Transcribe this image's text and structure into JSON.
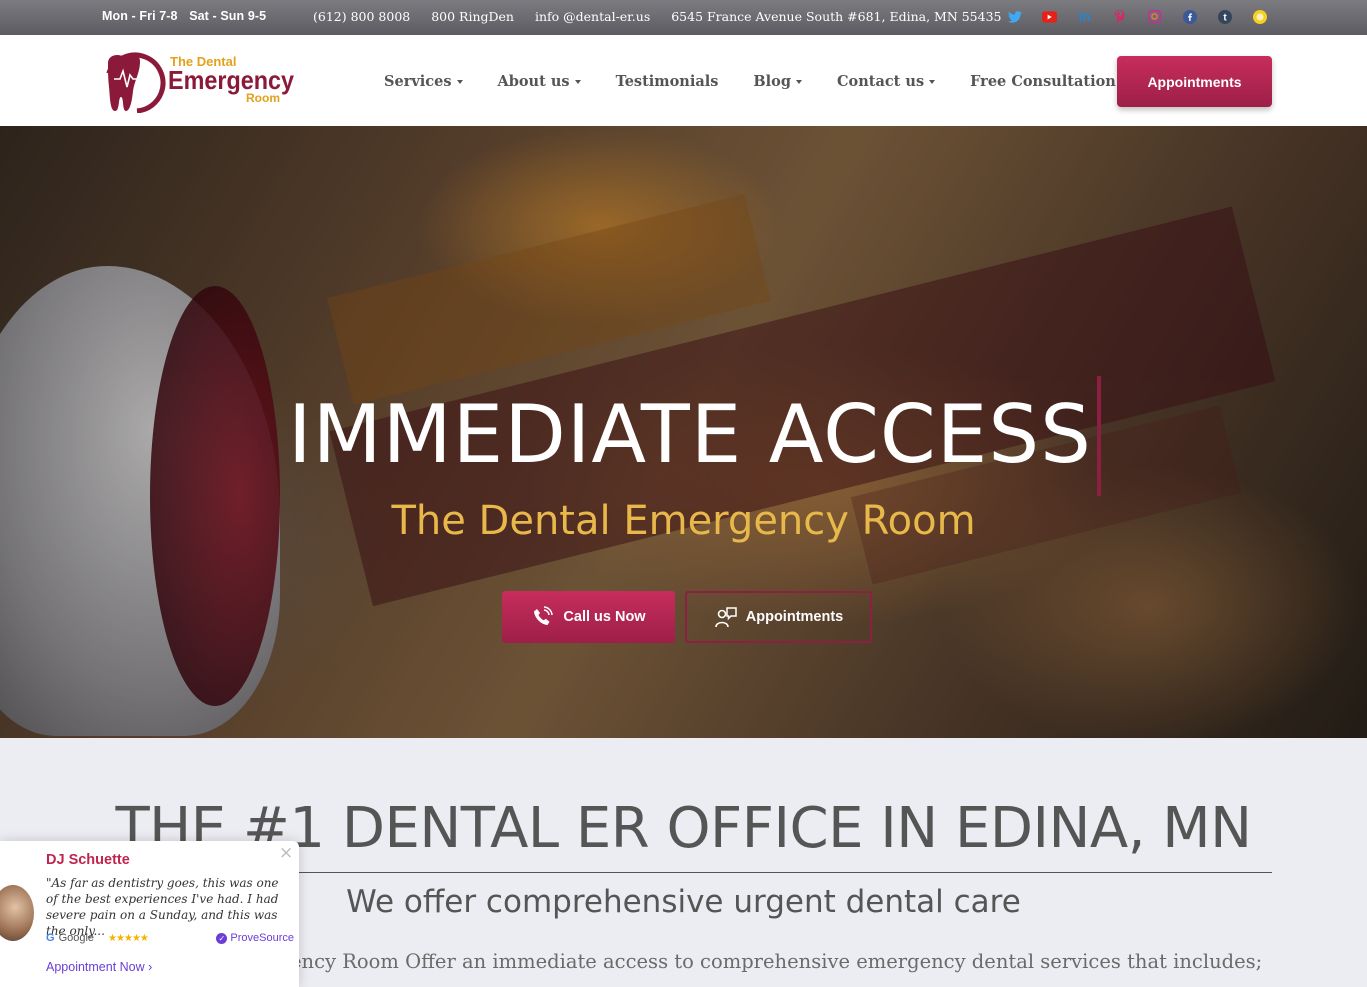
{
  "topbar": {
    "hours_weekday": "Mon - Fri 7-8",
    "hours_weekend": "Sat - Sun 9-5",
    "phone": "(612) 800 8008",
    "phone_alt": "800 RingDen",
    "email": "info @dental-er.us",
    "address": "6545 France Avenue South #681, Edina, MN 55435",
    "social": [
      {
        "name": "twitter-icon",
        "color": "#3fa9f5"
      },
      {
        "name": "youtube-icon",
        "color": "#e62117"
      },
      {
        "name": "linkedin-icon",
        "color": "#1e88d6"
      },
      {
        "name": "pinterest-icon",
        "color": "#e0245e"
      },
      {
        "name": "instagram-icon",
        "color": "#d6249f"
      },
      {
        "name": "facebook-icon",
        "color": "#3b5998"
      },
      {
        "name": "tumblr-icon",
        "color": "#35465c"
      },
      {
        "name": "yelp-icon",
        "color": "#f5d020"
      }
    ]
  },
  "nav": {
    "logo": {
      "line1": "The Dental",
      "line2": "Emergency",
      "line3": "Room"
    },
    "items": [
      {
        "label": "Services",
        "dropdown": true
      },
      {
        "label": "About us",
        "dropdown": true
      },
      {
        "label": "Testimonials",
        "dropdown": false
      },
      {
        "label": "Blog",
        "dropdown": true
      },
      {
        "label": "Contact us",
        "dropdown": true
      },
      {
        "label": "Free Consultation",
        "dropdown": false
      }
    ],
    "appointments_label": "Appointments"
  },
  "hero": {
    "title": "IMMEDIATE ACCESS",
    "subtitle": "The Dental Emergency Room",
    "call_label": "Call us Now",
    "appointments_label": "Appointments"
  },
  "section": {
    "title": "THE #1 DENTAL ER OFFICE IN EDINA, MN",
    "subtitle": "We offer comprehensive urgent dental care",
    "body": "ency Room Offer an immediate access to comprehensive emergency dental services that includes;"
  },
  "review": {
    "name": "DJ Schuette",
    "quote": "\"As far as dentistry goes, this was one of the best experiences I've had. I had severe pain on a Sunday, and this was the only...",
    "source": "Google",
    "verified_by": "ProveSource",
    "cta": "Appointment Now"
  },
  "colors": {
    "brand": "#b02552",
    "accent_gold": "#e8b84a"
  }
}
